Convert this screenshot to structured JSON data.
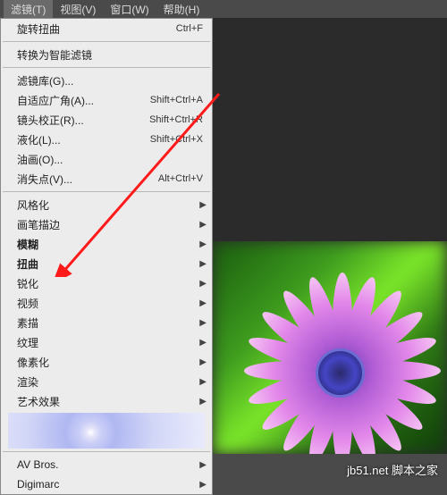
{
  "menubar": {
    "items": [
      {
        "label": "滤镜(T)",
        "active": true
      },
      {
        "label": "视图(V)",
        "active": false
      },
      {
        "label": "窗口(W)",
        "active": false
      },
      {
        "label": "帮助(H)",
        "active": false
      }
    ]
  },
  "dropdown": {
    "groups": [
      [
        {
          "label": "旋转扭曲",
          "shortcut": "Ctrl+F",
          "submenu": false,
          "bold": false
        }
      ],
      [
        {
          "label": "转换为智能滤镜",
          "shortcut": "",
          "submenu": false,
          "bold": false
        }
      ],
      [
        {
          "label": "滤镜库(G)...",
          "shortcut": "",
          "submenu": false,
          "bold": false
        },
        {
          "label": "自适应广角(A)...",
          "shortcut": "Shift+Ctrl+A",
          "submenu": false,
          "bold": false
        },
        {
          "label": "镜头校正(R)...",
          "shortcut": "Shift+Ctrl+R",
          "submenu": false,
          "bold": false
        },
        {
          "label": "液化(L)...",
          "shortcut": "Shift+Ctrl+X",
          "submenu": false,
          "bold": false
        },
        {
          "label": "油画(O)...",
          "shortcut": "",
          "submenu": false,
          "bold": false
        },
        {
          "label": "消失点(V)...",
          "shortcut": "Alt+Ctrl+V",
          "submenu": false,
          "bold": false
        }
      ],
      [
        {
          "label": "风格化",
          "shortcut": "",
          "submenu": true,
          "bold": false
        },
        {
          "label": "画笔描边",
          "shortcut": "",
          "submenu": true,
          "bold": false
        },
        {
          "label": "模糊",
          "shortcut": "",
          "submenu": true,
          "bold": true
        },
        {
          "label": "扭曲",
          "shortcut": "",
          "submenu": true,
          "bold": true
        },
        {
          "label": "锐化",
          "shortcut": "",
          "submenu": true,
          "bold": false
        },
        {
          "label": "视频",
          "shortcut": "",
          "submenu": true,
          "bold": false
        },
        {
          "label": "素描",
          "shortcut": "",
          "submenu": true,
          "bold": false
        },
        {
          "label": "纹理",
          "shortcut": "",
          "submenu": true,
          "bold": false
        },
        {
          "label": "像素化",
          "shortcut": "",
          "submenu": true,
          "bold": false
        },
        {
          "label": "渲染",
          "shortcut": "",
          "submenu": true,
          "bold": false
        },
        {
          "label": "艺术效果",
          "shortcut": "",
          "submenu": true,
          "bold": false
        }
      ],
      [
        {
          "label": "AV Bros.",
          "shortcut": "",
          "submenu": true,
          "bold": false
        },
        {
          "label": "Digimarc",
          "shortcut": "",
          "submenu": true,
          "bold": false
        }
      ]
    ]
  },
  "watermark": {
    "text": "脚本之家",
    "url": "jb51.net"
  },
  "arrow_target": "扭曲"
}
